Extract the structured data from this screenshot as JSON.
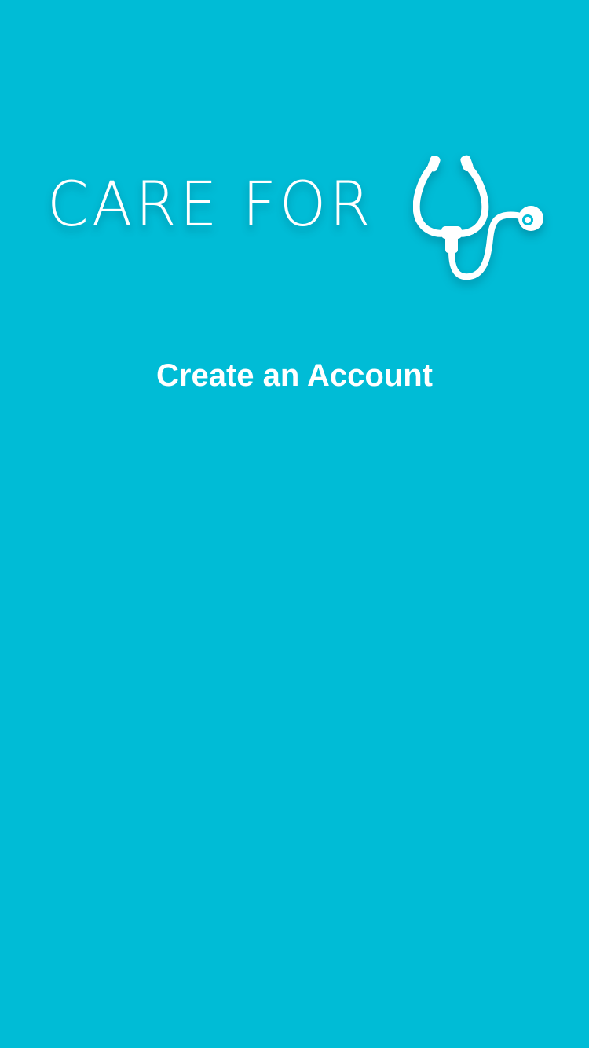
{
  "brand": {
    "text": "CARE FOR",
    "icon": "stethoscope-icon",
    "background_color": "#00bcd6",
    "text_color": "#ffffff"
  },
  "actions": {
    "create_account_label": "Create an Account"
  }
}
